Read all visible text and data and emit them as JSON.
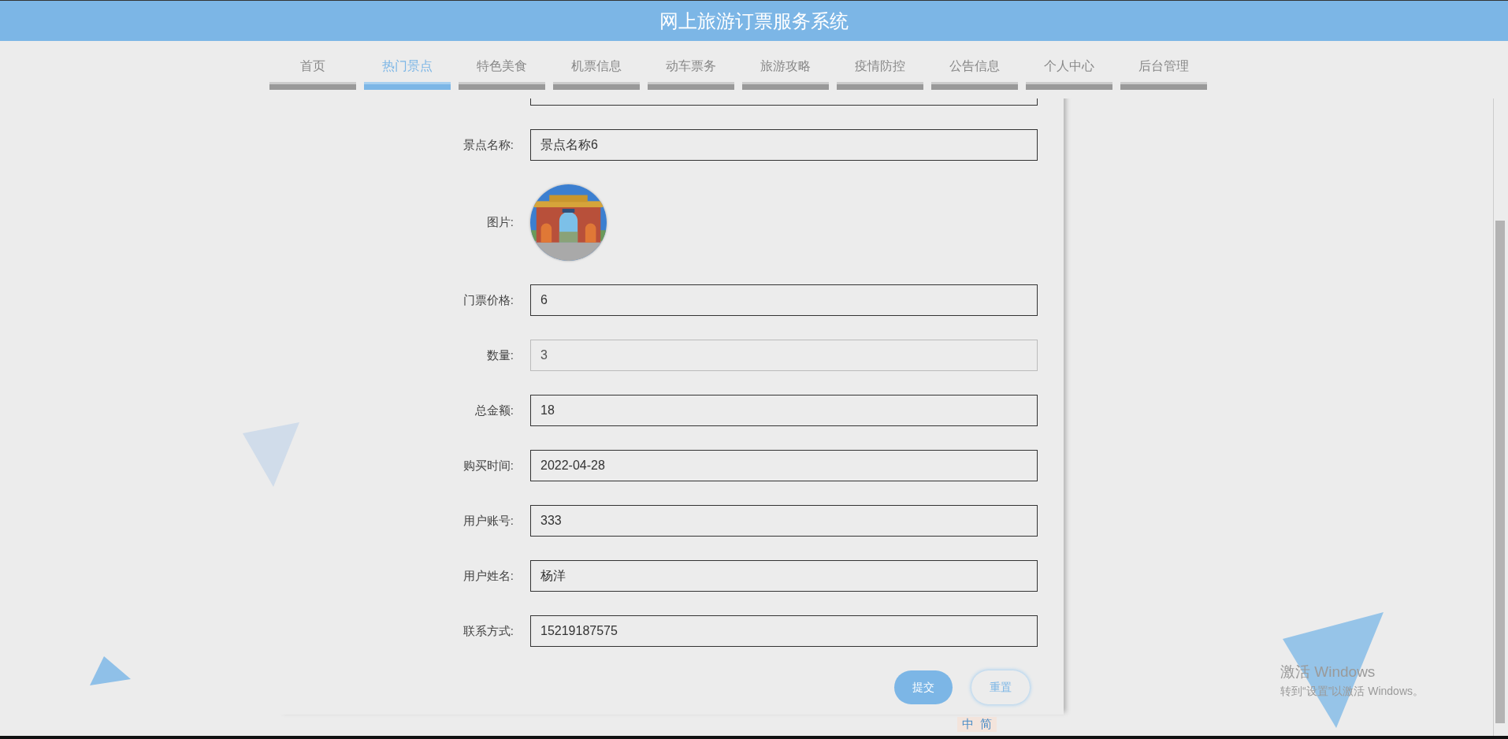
{
  "header": {
    "title": "网上旅游订票服务系统"
  },
  "nav": [
    {
      "label": "首页",
      "selected": false
    },
    {
      "label": "热门景点",
      "selected": true
    },
    {
      "label": "特色美食",
      "selected": false
    },
    {
      "label": "机票信息",
      "selected": false
    },
    {
      "label": "动车票务",
      "selected": false
    },
    {
      "label": "旅游攻略",
      "selected": false
    },
    {
      "label": "疫情防控",
      "selected": false
    },
    {
      "label": "公告信息",
      "selected": false
    },
    {
      "label": "个人中心",
      "selected": false
    },
    {
      "label": "后台管理",
      "selected": false
    }
  ],
  "form": {
    "fields": [
      {
        "kind": "text",
        "label": "景点名称:",
        "value": "景点名称6",
        "disabled": false
      },
      {
        "kind": "picture",
        "label": "图片:"
      },
      {
        "kind": "text",
        "label": "门票价格:",
        "value": "6",
        "disabled": false
      },
      {
        "kind": "text",
        "label": "数量:",
        "value": "3",
        "disabled": true
      },
      {
        "kind": "text",
        "label": "总金额:",
        "value": "18",
        "disabled": false
      },
      {
        "kind": "text",
        "label": "购买时间:",
        "value": "2022-04-28",
        "disabled": false
      },
      {
        "kind": "text",
        "label": "用户账号:",
        "value": "333",
        "disabled": false
      },
      {
        "kind": "text",
        "label": "用户姓名:",
        "value": "杨洋",
        "disabled": false
      },
      {
        "kind": "text",
        "label": "联系方式:",
        "value": "15219187575",
        "disabled": false
      }
    ],
    "buttons": [
      {
        "kind": "primary",
        "label": "提交"
      },
      {
        "kind": "secondary",
        "label": "重置"
      }
    ]
  },
  "ime_bar": [
    "中",
    "简"
  ],
  "activation": {
    "title": "激活 Windows",
    "message": "转到“设置”以激活 Windows。"
  }
}
